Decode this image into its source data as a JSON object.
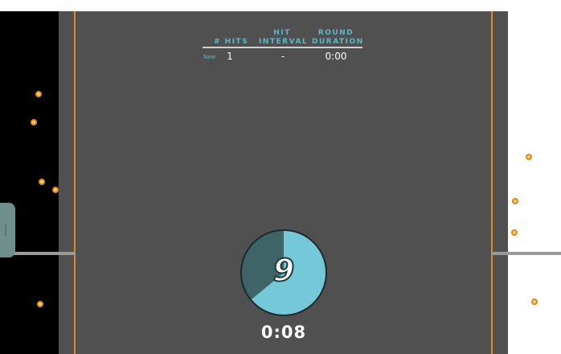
{
  "table": {
    "headers": {
      "hits": "# HITS",
      "interval_line1": "HIT",
      "interval_line2": "INTERVAL",
      "duration_line1": "ROUND",
      "duration_line2": "DURATION"
    },
    "rows": [
      {
        "badge": "New",
        "hits": "1",
        "interval": "-",
        "duration": "0:00"
      }
    ]
  },
  "timer": {
    "countdown": "9",
    "remaining_fraction": 0.64,
    "elapsed": "0:08"
  },
  "colors": {
    "accent": "#5bb8c6",
    "orange": "#e08a1e",
    "pie_fill": "#74c9d8",
    "pie_dark": "#3e6468",
    "panel": "#505050"
  },
  "icons": {
    "target_dot": "orange-ring-dot",
    "side_handle": "drawer-handle"
  }
}
